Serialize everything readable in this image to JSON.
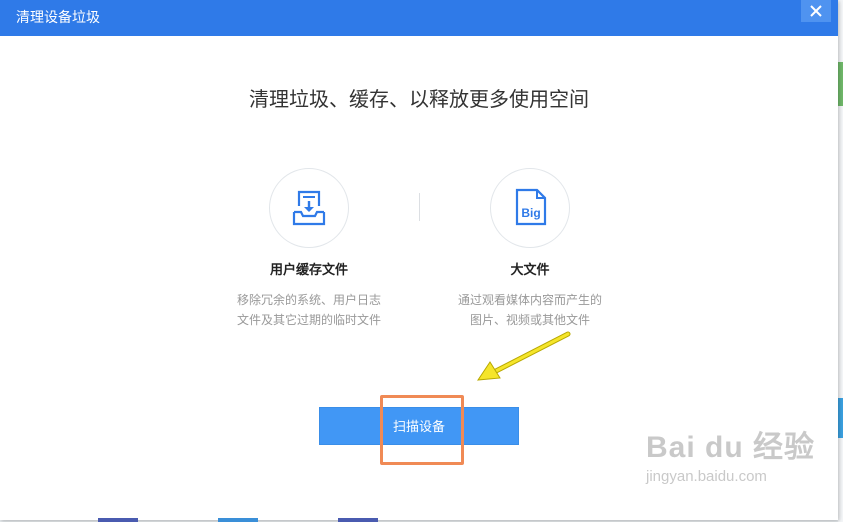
{
  "dialog": {
    "title": "清理设备垃圾",
    "headline": "清理垃圾、缓存、以释放更多使用空间"
  },
  "items": [
    {
      "title": "用户缓存文件",
      "desc_line1": "移除冗余的系统、用户日志",
      "desc_line2": "文件及其它过期的临时文件",
      "icon": "inbox-download-icon"
    },
    {
      "title": "大文件",
      "desc_line1": "通过观看媒体内容而产生的",
      "desc_line2": "图片、视频或其他文件",
      "icon": "big-file-icon",
      "icon_text": "Big"
    }
  ],
  "scan_button": {
    "label": "扫描设备"
  },
  "watermark": {
    "main": "Bai du 经验",
    "sub": "jingyan.baidu.com"
  },
  "colors": {
    "titlebar": "#2f7ae8",
    "button": "#4197f5",
    "highlight": "#f08a55",
    "arrow": "#f5e52a",
    "icon_blue": "#2f7ae8"
  }
}
